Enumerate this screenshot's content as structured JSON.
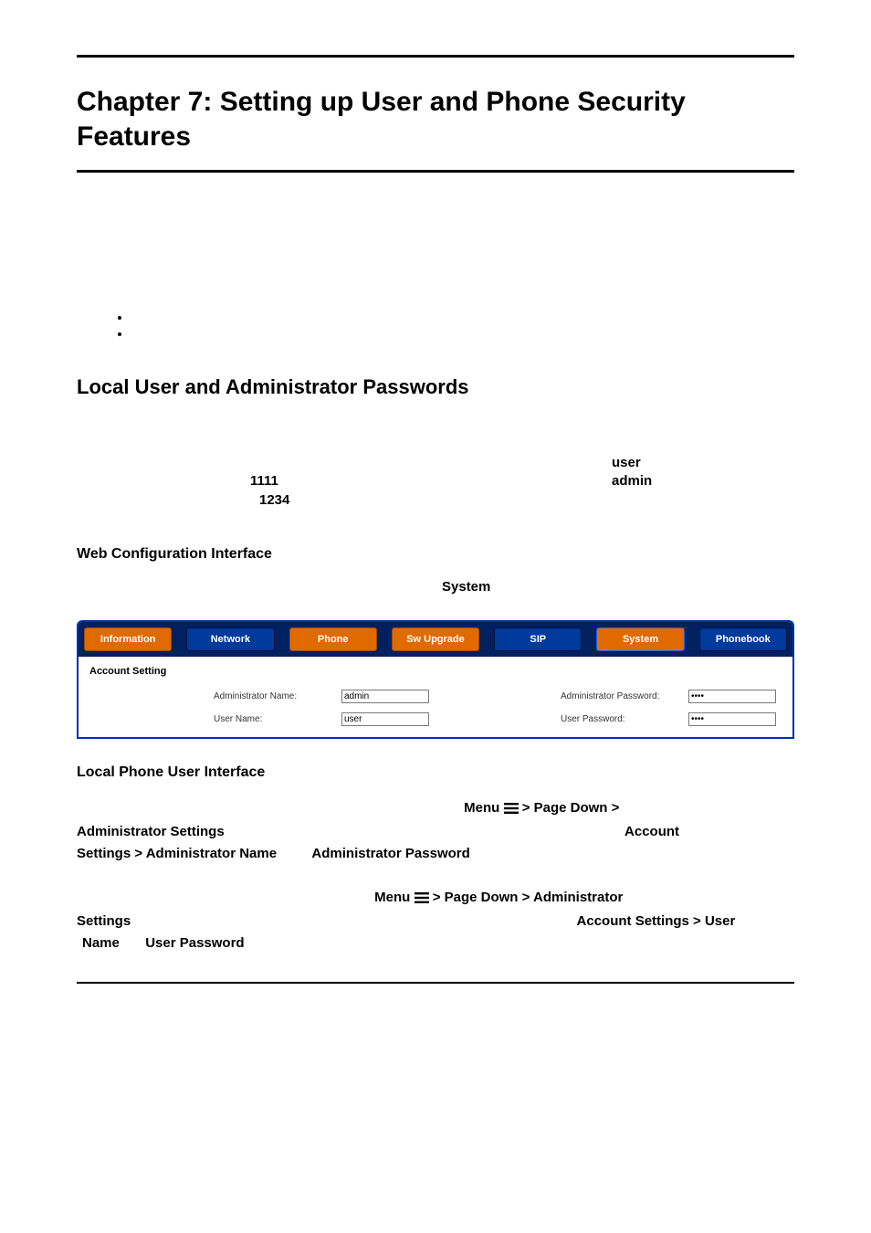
{
  "chapter_title": "Chapter 7: Setting up User and Phone Security Features",
  "section_title": "Local User and Administrator Passwords",
  "defaults": {
    "user_label": "user",
    "user_pwd": "1111",
    "admin_label": "admin",
    "admin_pwd": "1234"
  },
  "web_iface_title": "Web Configuration Interface",
  "system_word": "System",
  "tabs": {
    "information": "Information",
    "network": "Network",
    "phone": "Phone",
    "swupgrade": "Sw Upgrade",
    "sip": "SIP",
    "system": "System",
    "phonebook": "Phonebook"
  },
  "account": {
    "heading": "Account Setting",
    "admin_name_label": "Administrator Name:",
    "admin_name_value": "admin",
    "admin_pwd_label": "Administrator Password:",
    "admin_pwd_value": "••••",
    "user_name_label": "User Name:",
    "user_name_value": "user",
    "user_pwd_label": "User Password:",
    "user_pwd_value": "••••"
  },
  "local_iface_title": "Local Phone User Interface",
  "menu1": {
    "pre": "Menu",
    "rest1": " > Page Down >",
    "admin_settings": "Administrator Settings",
    "account": "Account",
    "settings_gt_admin_name": "Settings > Administrator Name",
    "admin_password": "Administrator Password"
  },
  "menu2": {
    "pre": "Menu",
    "rest1": " > Page Down > Administrator",
    "settings": "Settings",
    "account_user": "Account Settings > User",
    "name": "Name",
    "user_password": "User Password"
  }
}
